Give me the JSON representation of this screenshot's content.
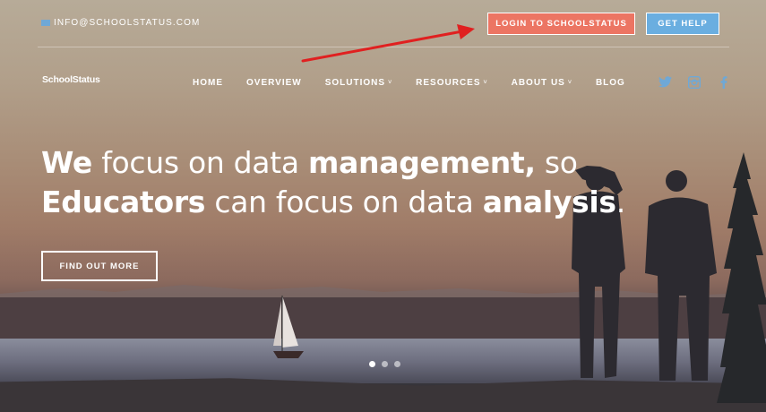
{
  "topbar": {
    "email": "INFO@SCHOOLSTATUS.COM",
    "email_icon": "mail-icon",
    "login_label": "LOGIN TO SCHOOLSTATUS",
    "help_label": "GET HELP"
  },
  "brand": {
    "logo": "SchoolStatus"
  },
  "nav": {
    "items": [
      {
        "label": "HOME",
        "dropdown": false
      },
      {
        "label": "OVERVIEW",
        "dropdown": false
      },
      {
        "label": "SOLUTIONS",
        "dropdown": true
      },
      {
        "label": "RESOURCES",
        "dropdown": true
      },
      {
        "label": "ABOUT US",
        "dropdown": true
      },
      {
        "label": "BLOG",
        "dropdown": false
      }
    ],
    "chevron": "˅"
  },
  "social": [
    "twitter-icon",
    "instagram-icon",
    "facebook-icon"
  ],
  "hero": {
    "line1": [
      {
        "text": "We",
        "bold": true
      },
      {
        "text": " focus on data ",
        "bold": false
      },
      {
        "text": "management,",
        "bold": true
      },
      {
        "text": " so",
        "bold": false
      }
    ],
    "line2": [
      {
        "text": "Educators",
        "bold": true
      },
      {
        "text": " can focus on data ",
        "bold": false
      },
      {
        "text": "analysis",
        "bold": true
      },
      {
        "text": ".",
        "bold": false
      }
    ],
    "cta_label": "FIND OUT MORE"
  },
  "carousel": {
    "slides": 3,
    "active": 0
  },
  "colors": {
    "login_button": "#ec7563",
    "help_button": "#6aaee0",
    "social_icon": "#6fa8d6",
    "annotation_arrow": "#e02020"
  }
}
